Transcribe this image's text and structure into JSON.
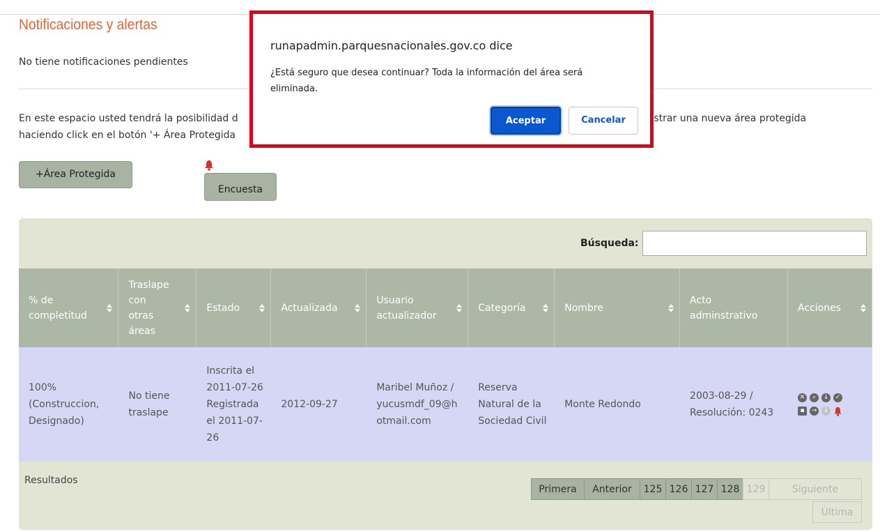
{
  "notifications": {
    "title": "Notificaciones y alertas",
    "empty_text": "No tiene notificaciones pendientes"
  },
  "intro": {
    "line1_left": "En este espacio usted tendrá la posibilidad d",
    "line1_right": "egistrar una nueva área protegida",
    "line2": "haciendo click en el botón '+ Área Protegida"
  },
  "buttons": {
    "add_area": "+Área Protegida",
    "survey": "Encuesta"
  },
  "search": {
    "label": "Búsqueda:",
    "value": ""
  },
  "table": {
    "columns": [
      "% de completitud",
      "Traslape con otras áreas",
      "Estado",
      "Actualizada",
      "Usuario actualizador",
      "Categoría",
      "Nombre",
      "Acto adminstrativo",
      "Acciones"
    ],
    "rows": [
      {
        "completitud": "100% (Construccion, Designado)",
        "traslape": "No tiene traslape",
        "estado": "Inscrita el 2011-07-26 Registrada el 2011-07-26",
        "actualizada": "2012-09-27",
        "usuario": "Maribel Muñoz / yucusmdf_09@hotmail.com",
        "categoria": "Reserva Natural de la Sociedad Civil",
        "nombre": "Monte Redondo",
        "acto": "2003-08-29 / Resolución: 0243"
      }
    ],
    "action_icons": [
      "delete-icon",
      "search-icon",
      "download-icon",
      "check-icon",
      "image-icon",
      "arrow-right-icon",
      "download-disabled-icon",
      "bell-icon"
    ]
  },
  "footer": {
    "results_label": "Resultados"
  },
  "pagination": {
    "first": "Primera",
    "previous": "Anterior",
    "pages": [
      "125",
      "126",
      "127",
      "128",
      "129"
    ],
    "current": "129",
    "next": "Siguiente",
    "last": "Última"
  },
  "dialog": {
    "site": "runapadmin.parquesnacionales.gov.co dice",
    "message": "¿Está seguro que desea continuar? Toda la información del área será eliminada.",
    "ok": "Aceptar",
    "cancel": "Cancelar"
  },
  "colors": {
    "title_accent": "#f0612f",
    "table_header": "#adb7a5",
    "row_bg": "#d5d7f5",
    "panel_bg": "#e3e5d4",
    "dialog_border": "#e1001a",
    "dialog_primary": "#0b57d0",
    "bell": "#d9302a"
  }
}
